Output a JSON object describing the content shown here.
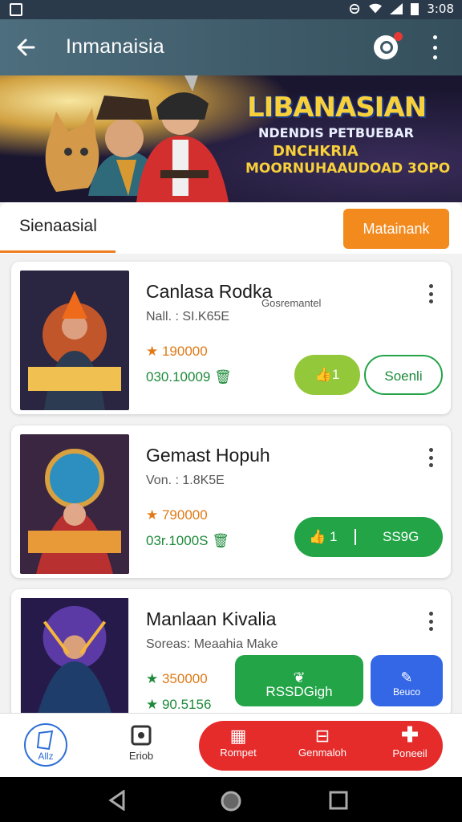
{
  "status_bar": {
    "time": "3:08",
    "icons": [
      "notification-icon",
      "dnd-icon",
      "wifi-icon",
      "signal-icon",
      "battery-icon"
    ]
  },
  "app_bar": {
    "title": "Inmanaisia"
  },
  "banner": {
    "title": "LIBANASIAN",
    "line1": "NDENDIS PETBUEBAR",
    "line2": "DNCHKRIA",
    "line3": "MOORNUHAAUDOAD 3OPO"
  },
  "tabs": {
    "active_label": "Sienaasial",
    "action_label": "Matainank"
  },
  "cards": [
    {
      "title": "Canlasa Rodka",
      "subtitle": "Nall. : SI.K65E",
      "note": "Gosremantel",
      "rating": "190000",
      "price": "030.10009",
      "pill_left": "1",
      "pill_right": "Soenli"
    },
    {
      "title": "Gemast Hopuh",
      "subtitle": "Von. : 1.8K5E",
      "note": "",
      "rating": "790000",
      "price": "03r.1000S",
      "pill_left": "1",
      "pill_right": "SS9G"
    },
    {
      "title": "Manlaan Kivalia",
      "subtitle": "Soreas: Meaahia Make",
      "note": "",
      "rating": "350000",
      "price": "90.5156",
      "pill_green": "RSSDGigh",
      "pill_blue": "Beuco"
    }
  ],
  "bottom_nav": {
    "item_a": "Allz",
    "item_b": "Eriob",
    "item_1": "Rompet",
    "item_2": "Genmaloh",
    "item_3": "Poneeil"
  },
  "colors": {
    "accent_orange": "#f28a1e",
    "accent_green": "#22a447",
    "accent_lime": "#93c83a",
    "accent_blue": "#3367e6",
    "accent_red": "#e62b2b"
  }
}
